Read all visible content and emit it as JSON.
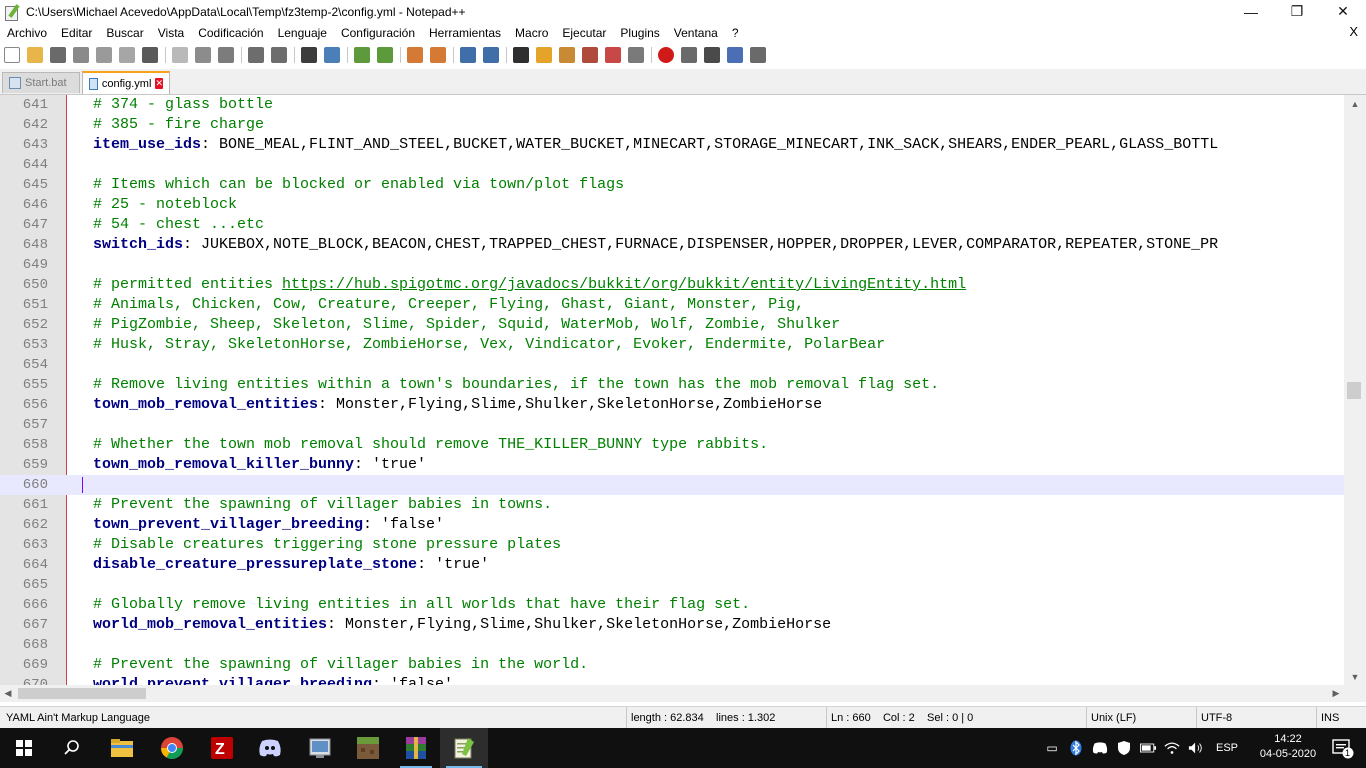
{
  "window": {
    "title": "C:\\Users\\Michael Acevedo\\AppData\\Local\\Temp\\fz3temp-2\\config.yml - Notepad++",
    "controls": {
      "minimize": "—",
      "maximize": "❐",
      "close": "✕"
    }
  },
  "menu": {
    "items": [
      "Archivo",
      "Editar",
      "Buscar",
      "Vista",
      "Codificación",
      "Lenguaje",
      "Configuración",
      "Herramientas",
      "Macro",
      "Ejecutar",
      "Plugins",
      "Ventana",
      "?"
    ],
    "close_doc": "X"
  },
  "toolbar": {
    "buttons": [
      "new-file-icon",
      "open-file-icon",
      "save-icon",
      "save-all-icon",
      "close-icon",
      "close-all-icon",
      "print-icon",
      "cut-icon",
      "copy-icon",
      "paste-icon",
      "undo-icon",
      "redo-icon",
      "find-icon",
      "replace-icon",
      "zoom-in-icon",
      "zoom-out-icon",
      "sync-vertical-icon",
      "sync-horizontal-icon",
      "word-wrap-icon",
      "show-all-chars-icon",
      "indent-guide-icon",
      "doc-map-icon",
      "function-list-icon",
      "folder-workspace-icon",
      "monitoring-icon",
      "record-macro-icon",
      "stop-macro-icon",
      "play-macro-icon",
      "run-macro-multiple-icon",
      "save-macro-icon"
    ]
  },
  "tabs": [
    {
      "label": "Start.bat",
      "active": false
    },
    {
      "label": "config.yml",
      "active": true
    }
  ],
  "editor": {
    "current_line": 660,
    "lines": [
      {
        "num": "641",
        "parts": [
          {
            "t": "# 374 - glass bottle",
            "c": "comment"
          }
        ]
      },
      {
        "num": "642",
        "parts": [
          {
            "t": "# 385 - fire charge",
            "c": "comment"
          }
        ]
      },
      {
        "num": "643",
        "parts": [
          {
            "t": "item_use_ids",
            "c": "key"
          },
          {
            "t": ": BONE_MEAL,FLINT_AND_STEEL,BUCKET,WATER_BUCKET,MINECART,STORAGE_MINECART,INK_SACK,SHEARS,ENDER_PEARL,GLASS_BOTTL",
            "c": "plain"
          }
        ]
      },
      {
        "num": "644",
        "parts": []
      },
      {
        "num": "645",
        "parts": [
          {
            "t": "# Items which can be blocked or enabled via town/plot flags",
            "c": "comment"
          }
        ]
      },
      {
        "num": "646",
        "parts": [
          {
            "t": "# 25 - noteblock",
            "c": "comment"
          }
        ]
      },
      {
        "num": "647",
        "parts": [
          {
            "t": "# 54 - chest ...etc",
            "c": "comment"
          }
        ]
      },
      {
        "num": "648",
        "parts": [
          {
            "t": "switch_ids",
            "c": "key"
          },
          {
            "t": ": JUKEBOX,NOTE_BLOCK,BEACON,CHEST,TRAPPED_CHEST,FURNACE,DISPENSER,HOPPER,DROPPER,LEVER,COMPARATOR,REPEATER,STONE_PR",
            "c": "plain"
          }
        ]
      },
      {
        "num": "649",
        "parts": []
      },
      {
        "num": "650",
        "parts": [
          {
            "t": "# permitted entities ",
            "c": "comment"
          },
          {
            "t": "https://hub.spigotmc.org/javadocs/bukkit/org/bukkit/entity/LivingEntity.html",
            "c": "link"
          }
        ]
      },
      {
        "num": "651",
        "parts": [
          {
            "t": "# Animals, Chicken, Cow, Creature, Creeper, Flying, Ghast, Giant, Monster, Pig,",
            "c": "comment"
          }
        ]
      },
      {
        "num": "652",
        "parts": [
          {
            "t": "# PigZombie, Sheep, Skeleton, Slime, Spider, Squid, WaterMob, Wolf, Zombie, Shulker",
            "c": "comment"
          }
        ]
      },
      {
        "num": "653",
        "parts": [
          {
            "t": "# Husk, Stray, SkeletonHorse, ZombieHorse, Vex, Vindicator, Evoker, Endermite, PolarBear",
            "c": "comment"
          }
        ]
      },
      {
        "num": "654",
        "parts": []
      },
      {
        "num": "655",
        "parts": [
          {
            "t": "# Remove living entities within a town's boundaries, if the town has the mob removal flag set.",
            "c": "comment"
          }
        ]
      },
      {
        "num": "656",
        "parts": [
          {
            "t": "town_mob_removal_entities",
            "c": "key"
          },
          {
            "t": ": Monster,Flying,Slime,Shulker,SkeletonHorse,ZombieHorse",
            "c": "plain"
          }
        ]
      },
      {
        "num": "657",
        "parts": []
      },
      {
        "num": "658",
        "parts": [
          {
            "t": "# Whether the town mob removal should remove THE_KILLER_BUNNY type rabbits.",
            "c": "comment"
          }
        ]
      },
      {
        "num": "659",
        "parts": [
          {
            "t": "town_mob_removal_killer_bunny",
            "c": "key"
          },
          {
            "t": ": 'true'",
            "c": "plain"
          }
        ]
      },
      {
        "num": "660",
        "parts": []
      },
      {
        "num": "661",
        "parts": [
          {
            "t": "# Prevent the spawning of villager babies in towns.",
            "c": "comment"
          }
        ]
      },
      {
        "num": "662",
        "parts": [
          {
            "t": "town_prevent_villager_breeding",
            "c": "key"
          },
          {
            "t": ": 'false'",
            "c": "plain"
          }
        ]
      },
      {
        "num": "663",
        "parts": [
          {
            "t": "# Disable creatures triggering stone pressure plates",
            "c": "comment"
          }
        ]
      },
      {
        "num": "664",
        "parts": [
          {
            "t": "disable_creature_pressureplate_stone",
            "c": "key"
          },
          {
            "t": ": 'true'",
            "c": "plain"
          }
        ]
      },
      {
        "num": "665",
        "parts": []
      },
      {
        "num": "666",
        "parts": [
          {
            "t": "# Globally remove living entities in all worlds that have their flag set.",
            "c": "comment"
          }
        ]
      },
      {
        "num": "667",
        "parts": [
          {
            "t": "world_mob_removal_entities",
            "c": "key"
          },
          {
            "t": ": Monster,Flying,Slime,Shulker,SkeletonHorse,ZombieHorse",
            "c": "plain"
          }
        ]
      },
      {
        "num": "668",
        "parts": []
      },
      {
        "num": "669",
        "parts": [
          {
            "t": "# Prevent the spawning of villager babies in the world.",
            "c": "comment"
          }
        ]
      },
      {
        "num": "670",
        "parts": [
          {
            "t": "world_prevent_villager_breeding",
            "c": "key"
          },
          {
            "t": ": 'false'",
            "c": "plain"
          }
        ]
      }
    ]
  },
  "statusbar": {
    "language": "YAML Ain't Markup Language",
    "length": "length : 62.834    lines : 1.302",
    "position": "Ln : 660    Col : 2    Sel : 0 | 0",
    "eol": "Unix (LF)",
    "encoding": "UTF-8",
    "mode": "INS"
  },
  "taskbar": {
    "apps": [
      "windows-start-icon",
      "search-icon",
      "file-explorer-icon",
      "chrome-icon",
      "filezilla-icon",
      "discord-icon",
      "app-icon",
      "minecraft-icon",
      "winrar-icon",
      "notepad-plus-plus-icon"
    ],
    "language": "ESP",
    "time": "14:22",
    "date": "04-05-2020",
    "notification_count": "1"
  }
}
